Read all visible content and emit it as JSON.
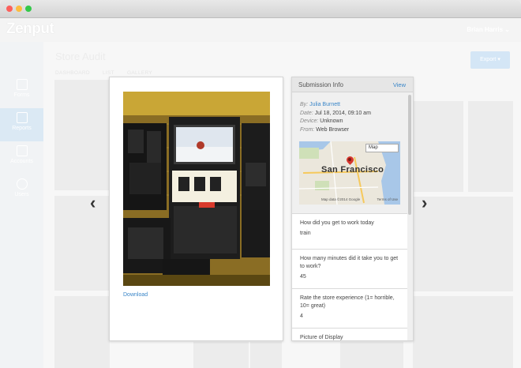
{
  "app": {
    "logo": "Zenput",
    "user": "Brian Harris ⌄"
  },
  "sidebar": {
    "items": [
      {
        "label": "Forms",
        "icon": "forms-icon"
      },
      {
        "label": "Reports",
        "icon": "reports-icon"
      },
      {
        "label": "Accounts",
        "icon": "accounts-icon"
      },
      {
        "label": "Users",
        "icon": "users-icon"
      }
    ]
  },
  "main": {
    "title": "Store Audit",
    "tabs": [
      "DASHBOARD",
      "LIST",
      "GALLERY"
    ],
    "export_label": "Export ▾"
  },
  "viewer": {
    "download_label": "Download",
    "info_title": "Submission Info",
    "view_label": "View",
    "by_label": "By:",
    "by_value": "Julia Burnett",
    "date_label": "Date:",
    "date_value": "Jul 18, 2014, 09:10 am",
    "device_label": "Device:",
    "device_value": "Unknown",
    "from_label": "From:",
    "from_value": "Web Browser",
    "map": {
      "select_label": "Map",
      "city_label": "San Francisco",
      "attribution": "Map data ©2014 Google",
      "terms": "Terms of Use"
    },
    "questions": [
      {
        "q": "How did you get to work today",
        "a": "train"
      },
      {
        "q": "How many minutes did it take you to get to work?",
        "a": "45"
      },
      {
        "q": "Rate the store experience (1= horrible, 10= great)",
        "a": "4"
      },
      {
        "q": "Picture of Display",
        "a": ""
      }
    ],
    "prev_arrow": "‹",
    "next_arrow": "›"
  },
  "colors": {
    "accent": "#3a86c8",
    "pin": "#d6362e"
  }
}
